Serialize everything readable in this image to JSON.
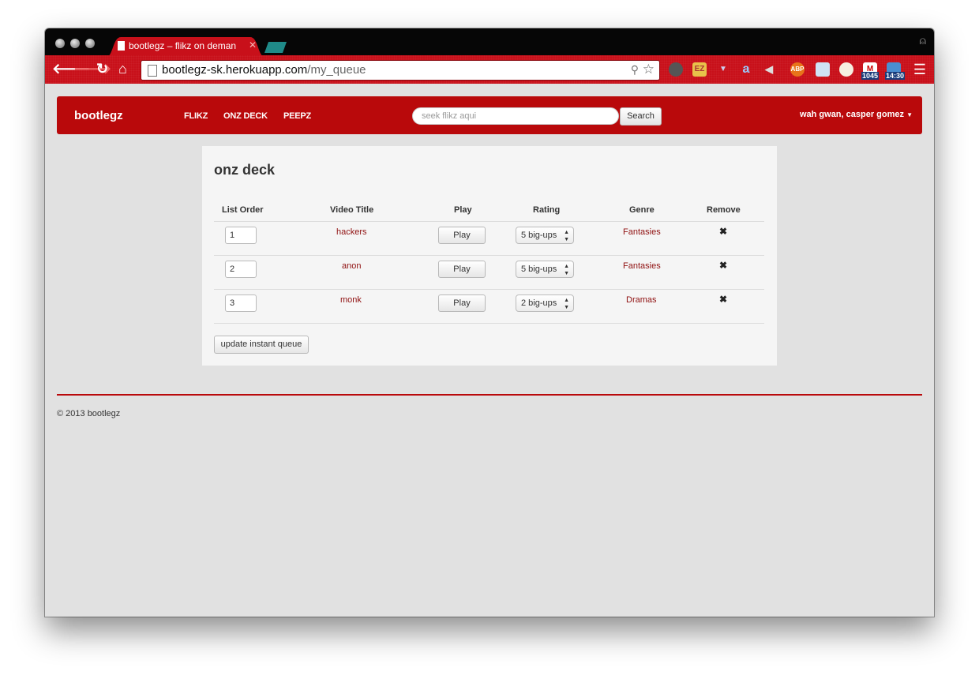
{
  "browser": {
    "tab_title": "bootlegz – flikz on deman",
    "url_host": "bootlegz-sk.herokuapp.com",
    "url_path": "/my_queue",
    "badges": {
      "mail_count": "1045",
      "clock_time": "14:30"
    },
    "abp_label": "ABP",
    "colors": {
      "chrome_red": "#c8101a",
      "nav_red": "#b9090b",
      "link_red": "#8f1010"
    }
  },
  "nav": {
    "brand": "bootlegz",
    "links": [
      "FLIKZ",
      "ONZ DECK",
      "PEEPZ"
    ],
    "search_placeholder": "seek flikz aqui",
    "search_button": "Search",
    "user_greeting": "wah gwan, casper gomez"
  },
  "queue": {
    "title": "onz deck",
    "headers": [
      "List Order",
      "Video Title",
      "Play",
      "Rating",
      "Genre",
      "Remove"
    ],
    "rows": [
      {
        "order": "1",
        "title": "hackers",
        "play": "Play",
        "rating": "5 big-ups",
        "genre": "Fantasies",
        "remove": "✖"
      },
      {
        "order": "2",
        "title": "anon",
        "play": "Play",
        "rating": "5 big-ups",
        "genre": "Fantasies",
        "remove": "✖"
      },
      {
        "order": "3",
        "title": "monk",
        "play": "Play",
        "rating": "2 big-ups",
        "genre": "Dramas",
        "remove": "✖"
      }
    ],
    "update_button": "update instant queue"
  },
  "footer": {
    "text": "© 2013 bootlegz"
  }
}
